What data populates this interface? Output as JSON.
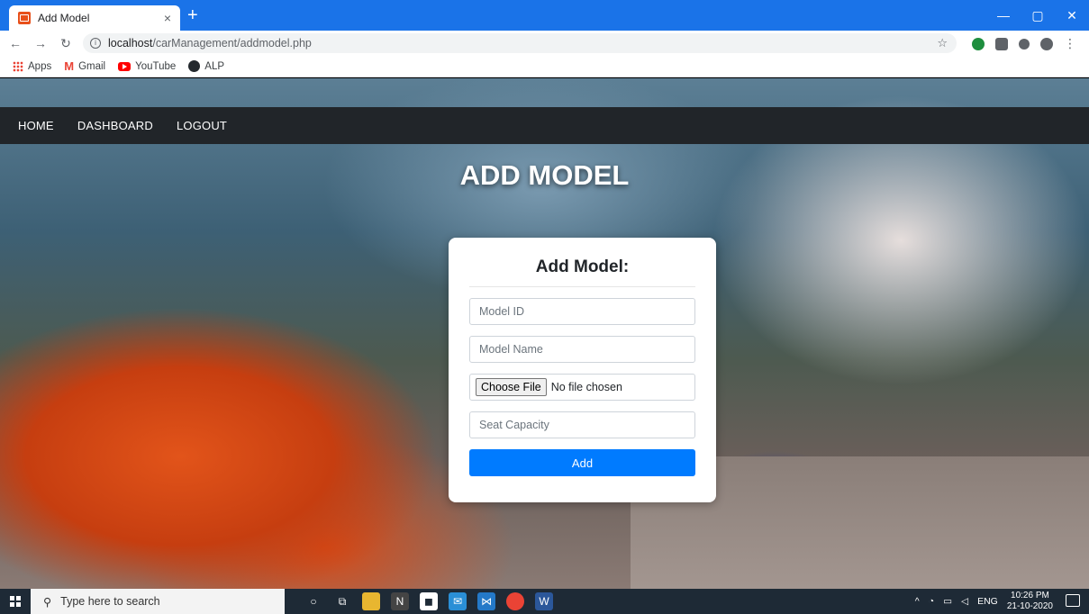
{
  "browser": {
    "tab_title": "Add Model",
    "tab_close": "×",
    "new_tab": "+",
    "url_host": "localhost",
    "url_path": "/carManagement/addmodel.php",
    "window_controls": [
      "—",
      "▢",
      "✕"
    ],
    "bookmarks": [
      "Apps",
      "Gmail",
      "YouTube",
      "ALP"
    ]
  },
  "nav": {
    "home": "HOME",
    "dashboard": "DASHBOARD",
    "logout": "LOGOUT"
  },
  "page": {
    "heading": "ADD MODEL"
  },
  "form": {
    "title": "Add Model:",
    "model_id_placeholder": "Model ID",
    "model_name_placeholder": "Model Name",
    "file_button": "Choose File",
    "file_status": "No file chosen",
    "seat_capacity_placeholder": "Seat Capacity",
    "submit_label": "Add",
    "accent_color": "#007bff"
  },
  "taskbar": {
    "search_placeholder": "Type here to search",
    "language": "ENG",
    "time": "10:26 PM",
    "date": "21-10-2020"
  }
}
